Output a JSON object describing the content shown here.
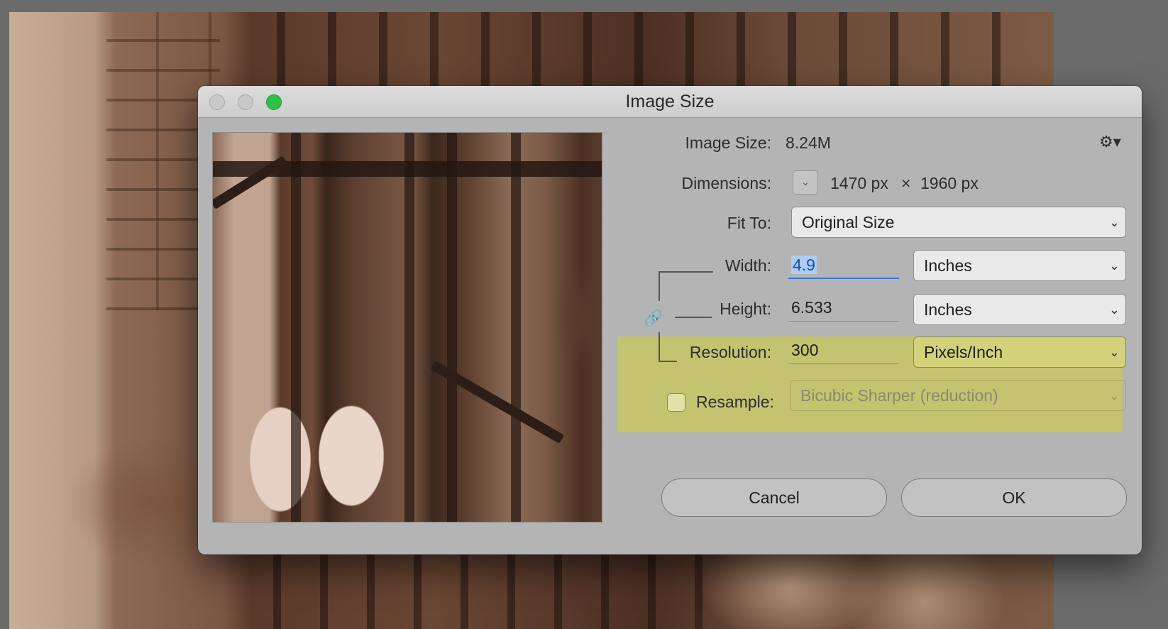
{
  "dialog": {
    "title": "Image Size",
    "image_size_label": "Image Size:",
    "image_size_value": "8.24M",
    "settings_icon": "gear-icon",
    "dimensions_label": "Dimensions:",
    "dimensions_width": "1470 px",
    "dimensions_times": "×",
    "dimensions_height": "1960 px",
    "fit_to_label": "Fit To:",
    "fit_to_value": "Original Size",
    "width_label": "Width:",
    "width_value": "4.9",
    "width_unit": "Inches",
    "height_label": "Height:",
    "height_value": "6.533",
    "height_unit": "Inches",
    "resolution_label": "Resolution:",
    "resolution_value": "300",
    "resolution_unit": "Pixels/Inch",
    "resample_label": "Resample:",
    "resample_checked": false,
    "resample_method": "Bicubic Sharper (reduction)",
    "cancel_label": "Cancel",
    "ok_label": "OK",
    "highlight_color": "#c5c46a",
    "zoom_button_color": "#2fc04a",
    "focus_color": "#3577d9"
  }
}
